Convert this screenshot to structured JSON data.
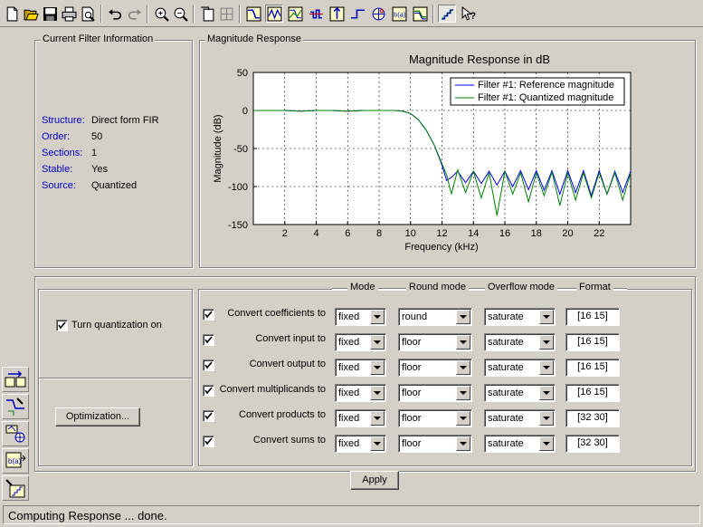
{
  "toolbar": {
    "buttons": [
      "new-icon",
      "open-icon",
      "save-icon",
      "print-icon",
      "print-preview-icon",
      "undo-icon",
      "redo-icon",
      "zoom-in-icon",
      "zoom-out-icon",
      "full-view-icon",
      "tile-icon",
      "magnitude-icon",
      "phase-icon",
      "mag-phase-icon",
      "group-delay-icon",
      "impulse-icon",
      "step-icon",
      "pole-zero-icon",
      "coefficients-icon",
      "magnitude-estimate-icon",
      "quantize-icon",
      "whats-this-icon"
    ]
  },
  "info": {
    "title": "Current Filter Information",
    "rows": [
      {
        "label": "Structure:",
        "value": "Direct form FIR"
      },
      {
        "label": "Order:",
        "value": "50"
      },
      {
        "label": "Sections:",
        "value": "1"
      },
      {
        "label": "Stable:",
        "value": "Yes"
      },
      {
        "label": "Source:",
        "value": "Quantized"
      }
    ]
  },
  "magnitude": {
    "group_title": "Magnitude Response",
    "legend": [
      "Filter #1: Reference magnitude",
      "Filter #1: Quantized magnitude"
    ],
    "colors": {
      "reference": "#0000ff",
      "quantized": "#008000"
    }
  },
  "chart_data": {
    "type": "line",
    "title": "Magnitude Response in dB",
    "xlabel": "Frequency (kHz)",
    "ylabel": "Magnitude (dB)",
    "xlim": [
      0,
      24
    ],
    "ylim": [
      -150,
      50
    ],
    "xticks": [
      2,
      4,
      6,
      8,
      10,
      12,
      14,
      16,
      18,
      20,
      22
    ],
    "yticks": [
      50,
      0,
      -50,
      -100,
      -150
    ],
    "grid": true,
    "legend_position": "top-right",
    "series": [
      {
        "name": "Filter #1: Reference magnitude",
        "color": "#0000ff",
        "x": [
          0,
          1,
          2,
          3,
          4,
          5,
          6,
          7,
          8,
          9,
          9.5,
          10,
          10.5,
          11,
          11.5,
          12,
          12.3,
          12.6,
          13,
          13.5,
          14,
          14.5,
          15,
          15.5,
          16,
          16.5,
          17,
          17.5,
          18,
          18.5,
          19,
          19.5,
          20,
          20.5,
          21,
          21.5,
          22,
          22.5,
          23,
          23.5,
          24
        ],
        "y": [
          0,
          0,
          0,
          -1,
          0,
          0,
          -1,
          0,
          0,
          0,
          -1,
          -4,
          -12,
          -26,
          -45,
          -72,
          -92,
          -88,
          -80,
          -95,
          -80,
          -96,
          -80,
          -98,
          -80,
          -100,
          -79,
          -104,
          -79,
          -105,
          -79,
          -110,
          -79,
          -108,
          -79,
          -112,
          -79,
          -110,
          -80,
          -108,
          -80
        ]
      },
      {
        "name": "Filter #1: Quantized magnitude",
        "color": "#008000",
        "x": [
          0,
          1,
          2,
          3,
          4,
          5,
          6,
          7,
          8,
          9,
          9.5,
          10,
          10.5,
          11,
          11.5,
          12,
          12.3,
          12.6,
          13,
          13.5,
          14,
          14.5,
          15,
          15.5,
          16,
          16.5,
          17,
          17.5,
          18,
          18.5,
          19,
          19.5,
          20,
          20.5,
          21,
          21.5,
          22,
          22.5,
          23,
          23.5,
          24
        ],
        "y": [
          0,
          0,
          0,
          -1,
          0,
          0,
          -1,
          0,
          0,
          0,
          -1,
          -4,
          -12,
          -26,
          -45,
          -70,
          -85,
          -110,
          -78,
          -108,
          -80,
          -115,
          -82,
          -138,
          -80,
          -110,
          -82,
          -120,
          -82,
          -112,
          -81,
          -125,
          -82,
          -118,
          -82,
          -115,
          -82,
          -110,
          -82,
          -118,
          -82
        ]
      }
    ]
  },
  "quant": {
    "turn_on_label": "Turn quantization on",
    "turn_on_checked": true,
    "optimization_label": "Optimization...",
    "headers": [
      "Mode",
      "Round mode",
      "Overflow mode",
      "Format"
    ],
    "rows": [
      {
        "label": "Convert coefficients to",
        "mode": "fixed",
        "round": "round",
        "overflow": "saturate",
        "format": "[16 15]"
      },
      {
        "label": "Convert input to",
        "mode": "fixed",
        "round": "floor",
        "overflow": "saturate",
        "format": "[16 15]"
      },
      {
        "label": "Convert output to",
        "mode": "fixed",
        "round": "floor",
        "overflow": "saturate",
        "format": "[16 15]"
      },
      {
        "label": "Convert multiplicands to",
        "mode": "fixed",
        "round": "floor",
        "overflow": "saturate",
        "format": "[16 15]"
      },
      {
        "label": "Convert products to",
        "mode": "fixed",
        "round": "floor",
        "overflow": "saturate",
        "format": "[32 30]"
      },
      {
        "label": "Convert sums to",
        "mode": "fixed",
        "round": "floor",
        "overflow": "saturate",
        "format": "[32 30]"
      }
    ],
    "apply_label": "Apply"
  },
  "side_toolbar": [
    "transform-filter-icon",
    "design-filter-icon",
    "pole-zero-editor-icon",
    "import-filter-icon",
    "quantize-filter-icon"
  ],
  "status": "Computing Response ... done."
}
